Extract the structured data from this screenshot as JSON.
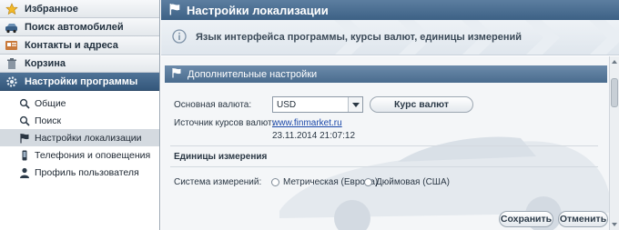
{
  "nav": {
    "categories": [
      {
        "label": "Избранное",
        "icon": "star-icon"
      },
      {
        "label": "Поиск автомобилей",
        "icon": "car-search-icon"
      },
      {
        "label": "Контакты и адреса",
        "icon": "contacts-icon"
      },
      {
        "label": "Корзина",
        "icon": "trash-icon"
      },
      {
        "label": "Настройки программы",
        "icon": "settings-gear-icon"
      }
    ],
    "items": [
      {
        "label": "Общие",
        "icon": "magnifier-icon"
      },
      {
        "label": "Поиск",
        "icon": "magnifier-icon"
      },
      {
        "label": "Настройки локализации",
        "icon": "flag-icon"
      },
      {
        "label": "Телефония и оповещения",
        "icon": "phone-icon"
      },
      {
        "label": "Профиль пользователя",
        "icon": "user-icon"
      }
    ]
  },
  "header": {
    "title": "Настройки локализации",
    "description": "Язык интерфейса программы, курсы валют, единицы измерений"
  },
  "section": {
    "title": "Дополнительные настройки",
    "base_currency_label": "Основная валюта:",
    "base_currency_value": "USD",
    "rates_button": "Курс валют",
    "source_label": "Источник курсов валют:",
    "source_link": "www.finmarket.ru",
    "source_date": "23.11.2014 21:07:12",
    "units_title": "Единицы измерения",
    "system_label": "Система измерений:",
    "option_metric": "Метрическая (Европа)",
    "option_imperial": "Дюймовая (США)"
  },
  "footer": {
    "save": "Сохранить",
    "cancel": "Отменить"
  },
  "colors": {
    "accent": "#3d6185",
    "link": "#1a47a8"
  }
}
